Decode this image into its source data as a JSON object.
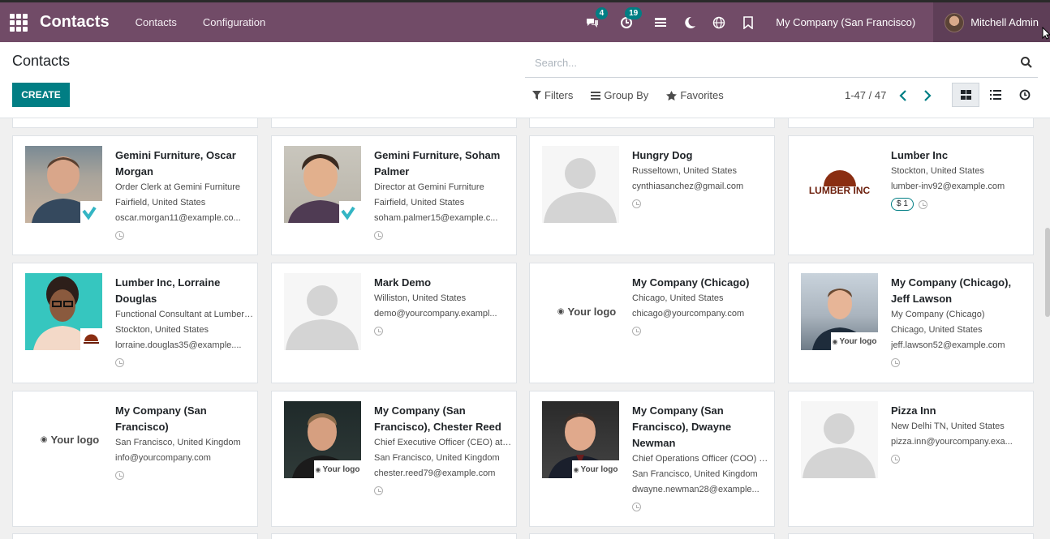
{
  "nav": {
    "app_title": "Contacts",
    "menu": [
      "Contacts",
      "Configuration"
    ],
    "messages_badge": "4",
    "activities_badge": "19",
    "company": "My Company (San Francisco)",
    "user": "Mitchell Admin"
  },
  "control": {
    "title": "Contacts",
    "create_label": "CREATE",
    "search_placeholder": "Search...",
    "filters_label": "Filters",
    "group_by_label": "Group By",
    "favorites_label": "Favorites",
    "pager": "1-47 / 47"
  },
  "cards": [
    {
      "name_lines": [
        "Gemini Furniture, Oscar",
        "Morgan"
      ],
      "lines": [
        "Order Clerk at Gemini Furniture",
        "Fairfield, United States",
        "oscar.morgan11@example.co..."
      ]
    },
    {
      "name_lines": [
        "Gemini Furniture, Soham",
        "Palmer"
      ],
      "lines": [
        "Director at Gemini Furniture",
        "Fairfield, United States",
        "soham.palmer15@example.c..."
      ]
    },
    {
      "name_lines": [
        "Hungry Dog"
      ],
      "lines": [
        "Russeltown, United States",
        "cynthiasanchez@gmail.com"
      ]
    },
    {
      "name_lines": [
        "Lumber Inc"
      ],
      "lines": [
        "Stockton, United States",
        "lumber-inv92@example.com"
      ],
      "tag": "$ 1",
      "logo": "LUMBER INC"
    },
    {
      "name_lines": [
        "Lumber Inc, Lorraine",
        "Douglas"
      ],
      "lines": [
        "Functional Consultant at Lumber ...",
        "Stockton, United States",
        "lorraine.douglas35@example...."
      ]
    },
    {
      "name_lines": [
        "Mark Demo"
      ],
      "lines": [
        "Williston, United States",
        "demo@yourcompany.exampl..."
      ]
    },
    {
      "name_lines": [
        "My Company (Chicago)"
      ],
      "lines": [
        "Chicago, United States",
        "chicago@yourcompany.com"
      ],
      "logo": "Your logo"
    },
    {
      "name_lines": [
        "My Company (Chicago),",
        "Jeff Lawson"
      ],
      "lines": [
        "My Company (Chicago)",
        "Chicago, United States",
        "jeff.lawson52@example.com"
      ],
      "corner_logo": "Your logo"
    },
    {
      "name_lines": [
        "My Company (San",
        "Francisco)"
      ],
      "lines": [
        "San Francisco, United Kingdom",
        "info@yourcompany.com"
      ],
      "logo": "Your logo"
    },
    {
      "name_lines": [
        "My Company (San",
        "Francisco), Chester Reed"
      ],
      "lines": [
        "Chief Executive Officer (CEO) at ...",
        "San Francisco, United Kingdom",
        "chester.reed79@example.com"
      ],
      "corner_logo": "Your logo"
    },
    {
      "name_lines": [
        "My Company (San",
        "Francisco), Dwayne",
        "Newman"
      ],
      "lines": [
        "Chief Operations Officer (COO) at...",
        "San Francisco, United Kingdom",
        "dwayne.newman28@example..."
      ],
      "corner_logo": "Your logo"
    },
    {
      "name_lines": [
        "Pizza Inn"
      ],
      "lines": [
        "New Delhi TN, United States",
        "pizza.inn@yourcompany.exa..."
      ]
    }
  ]
}
